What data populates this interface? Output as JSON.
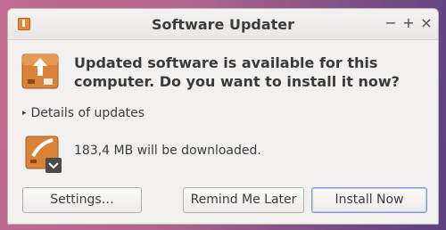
{
  "window": {
    "title": "Software Updater"
  },
  "controls": {
    "minimize": "−",
    "maximize": "+",
    "close": "×"
  },
  "message": {
    "headline": "Updated software is available for this computer. Do you want to install it now?"
  },
  "details": {
    "arrow": "▸",
    "label": "Details of updates"
  },
  "download": {
    "text": "183,4 MB will be downloaded."
  },
  "buttons": {
    "settings": "Settings…",
    "remind": "Remind Me Later",
    "install": "Install Now"
  },
  "colors": {
    "accent": "#e0893a",
    "primary_border": "#7c9fcf"
  }
}
